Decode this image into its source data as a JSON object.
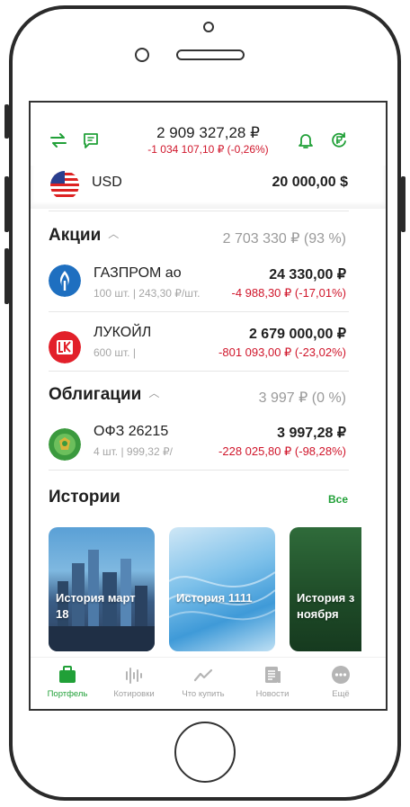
{
  "header": {
    "total_value": "2 909 327,28 ₽",
    "total_change": "-1 034 107,10 ₽ (-0,26%)"
  },
  "currency": {
    "name": "USD",
    "value": "20 000,00 $"
  },
  "stocks_section": {
    "title": "Акции",
    "total": "2 703 330 ₽ (93 %)",
    "items": [
      {
        "name": "ГАЗПРОМ ао",
        "sub": "100 шт. | 243,30 ₽/шт.",
        "value": "24 330,00 ₽",
        "change": "-4 988,30 ₽ (-17,01%)"
      },
      {
        "name": "ЛУКОЙЛ",
        "sub": "600 шт. |",
        "value": "2 679 000,00 ₽",
        "change": "-801 093,00 ₽ (-23,02%)"
      }
    ]
  },
  "bonds_section": {
    "title": "Облигации",
    "total": "3 997 ₽ (0 %)",
    "items": [
      {
        "name": "ОФЗ 26215",
        "sub": "4 шт. | 999,32 ₽/",
        "value": "3 997,28 ₽",
        "change": "-228 025,80 ₽ (-98,28%)"
      }
    ]
  },
  "stories": {
    "title": "Истории",
    "all_label": "Все",
    "items": [
      {
        "label": "История март 18"
      },
      {
        "label": "История 1111"
      },
      {
        "label": "История з ноября"
      }
    ]
  },
  "tabbar": [
    {
      "label": "Портфель",
      "icon": "briefcase-icon",
      "active": true
    },
    {
      "label": "Котировки",
      "icon": "quotes-icon",
      "active": false
    },
    {
      "label": "Что купить",
      "icon": "trend-icon",
      "active": false
    },
    {
      "label": "Новости",
      "icon": "news-icon",
      "active": false
    },
    {
      "label": "Ещё",
      "icon": "more-icon",
      "active": false
    }
  ],
  "colors": {
    "accent": "#21a038",
    "negative": "#d0162b",
    "muted": "#a6a6a6"
  }
}
